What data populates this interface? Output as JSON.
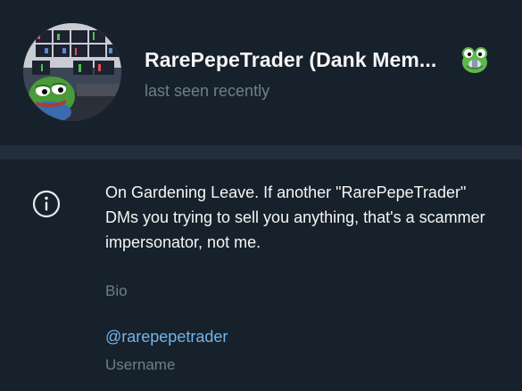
{
  "profile": {
    "name": "RarePepeTrader (Dank Mem...",
    "status": "last seen recently",
    "avatar_icon": "pepe-trader-avatar",
    "status_emoji_icon": "pepe-frog-emoji"
  },
  "info": {
    "bio_text": "On Gardening Leave. If another \"RarePepeTrader\" DMs you trying to sell you anything, that's a scammer impersonator, not me.",
    "bio_label": "Bio",
    "username_value": "@rarepepetrader",
    "username_label": "Username"
  },
  "colors": {
    "background": "#17212b",
    "divider": "#232e3c",
    "primary_text": "#f5f5f5",
    "secondary_text": "#6d7f8f",
    "link": "#71b4ec"
  }
}
